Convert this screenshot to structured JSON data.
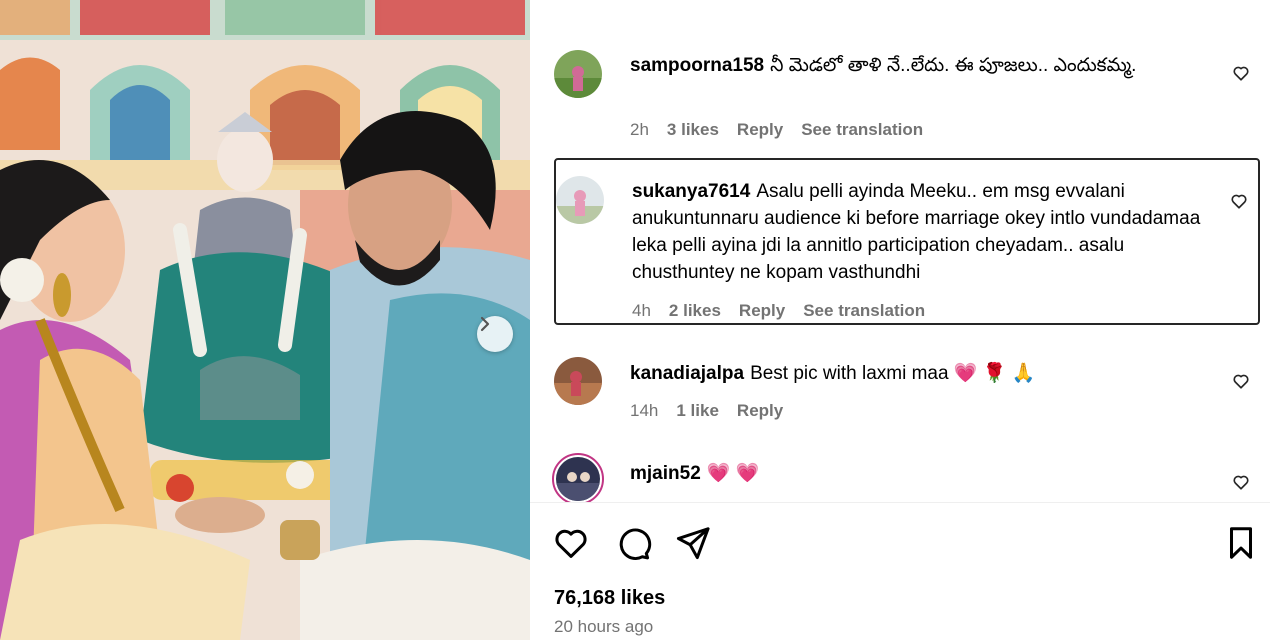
{
  "post": {
    "likes_text": "76,168 likes",
    "time_text": "20 hours ago"
  },
  "comments": [
    {
      "username": "sampoorna158",
      "text": "నీ మెడలో తాళి నే..లేదు. ఈ పూజలు.. ఎందుకమ్మ.",
      "age": "2h",
      "likes": "3 likes",
      "reply": "Reply",
      "translate": "See translation"
    },
    {
      "username": "sukanya7614",
      "text": "Asalu pelli ayinda Meeku.. em msg evvalani anukuntunnaru audience ki before marriage okey intlo vundadamaa leka pelli ayina jdi la annitlo participation cheyadam.. asalu chusthuntey ne kopam vasthundhi",
      "age": "4h",
      "likes": "2 likes",
      "reply": "Reply",
      "translate": "See translation"
    },
    {
      "username": "kanadiajalpa",
      "text": "Best pic with laxmi maa 💗 🌹 🙏",
      "age": "14h",
      "likes": "1 like",
      "reply": "Reply"
    },
    {
      "username": "mjain52",
      "text": "💗 💗"
    }
  ],
  "icons": {
    "like": "heart-icon",
    "comment": "comment-icon",
    "share": "share-icon",
    "save": "bookmark-icon",
    "carousel_next": "chevron-right-icon"
  },
  "colors": {
    "meta_gray": "#737373",
    "selected_border": "#262626"
  }
}
